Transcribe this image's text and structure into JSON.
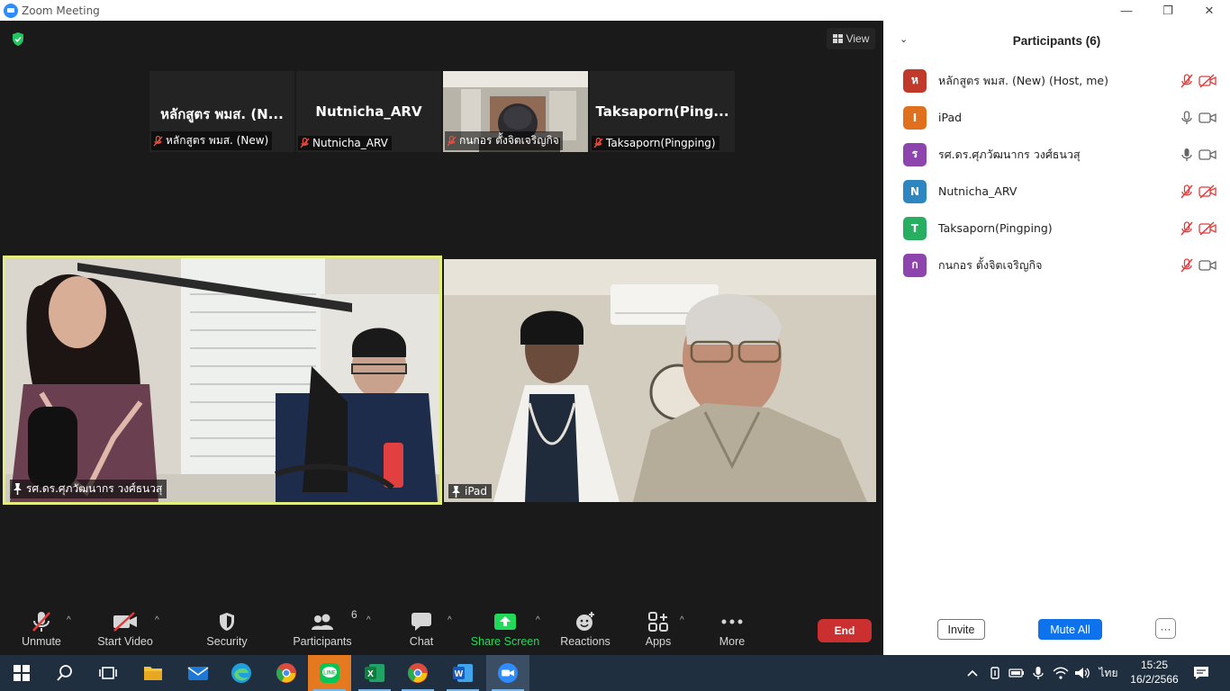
{
  "window": {
    "title": "Zoom Meeting",
    "minimize": "—",
    "restore": "❐",
    "close": "✕"
  },
  "meeting": {
    "view_label": "View",
    "thumbnails": [
      {
        "big_name": "หลักสูตร พมส. (N...",
        "label": "หลักสูตร พมส. (New)",
        "muted": true,
        "video": false
      },
      {
        "big_name": "Nutnicha_ARV",
        "label": "Nutnicha_ARV",
        "muted": true,
        "video": false
      },
      {
        "big_name": "",
        "label": "กนกอร ตั้งจิตเจริญกิจ",
        "muted": true,
        "video": true
      },
      {
        "big_name": "Taksaporn(Ping...",
        "label": "Taksaporn(Pingping)",
        "muted": true,
        "video": false
      }
    ],
    "tiles": [
      {
        "label": "รศ.ดร.ศุภวัฒนากร วงศ์ธนวสุ"
      },
      {
        "label": "iPad"
      }
    ],
    "active_speaker_border": "#e3ef7a"
  },
  "toolbar": {
    "unmute": "Unmute",
    "start_video": "Start Video",
    "security": "Security",
    "participants": "Participants",
    "participants_count": "6",
    "chat": "Chat",
    "share_screen": "Share Screen",
    "reactions": "Reactions",
    "apps": "Apps",
    "more": "More",
    "end": "End",
    "share_color": "#23d959",
    "end_color": "#cc2f2f"
  },
  "panel": {
    "title": "Participants (6)",
    "participants": [
      {
        "initial": "ห",
        "name": "หลักสูตร พมส. (New) (Host, me)",
        "color": "#c0392b",
        "mic_muted": true,
        "cam_off": true
      },
      {
        "initial": "I",
        "name": "iPad",
        "color": "#e0701e",
        "mic_muted": false,
        "cam_off": false
      },
      {
        "initial": "ร",
        "name": "รศ.ดร.ศุภวัฒนากร วงศ์ธนวสุ",
        "color": "#8e44ad",
        "mic_muted": false,
        "cam_off": false
      },
      {
        "initial": "N",
        "name": "Nutnicha_ARV",
        "color": "#2e86c1",
        "mic_muted": true,
        "cam_off": true
      },
      {
        "initial": "T",
        "name": "Taksaporn(Pingping)",
        "color": "#27ae60",
        "mic_muted": true,
        "cam_off": true
      },
      {
        "initial": "ก",
        "name": "กนกอร ตั้งจิตเจริญกิจ",
        "color": "#8e44ad",
        "mic_muted": true,
        "cam_off": false
      }
    ],
    "invite": "Invite",
    "mute_all": "Mute All",
    "more": "···",
    "accent": "#0e72ed"
  },
  "taskbar": {
    "language": "ไทย",
    "time": "15:25",
    "date": "16/2/2566"
  }
}
